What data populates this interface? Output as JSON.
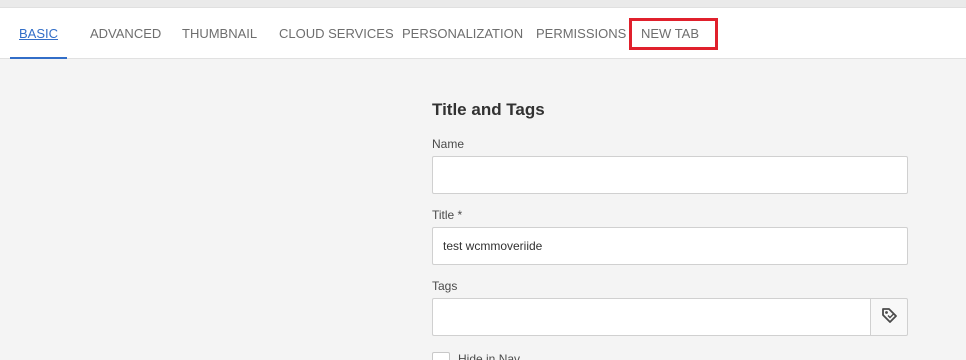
{
  "tabs": [
    {
      "label": "BASIC",
      "active": true
    },
    {
      "label": "ADVANCED",
      "active": false
    },
    {
      "label": "THUMBNAIL",
      "active": false
    },
    {
      "label": "CLOUD SERVICES",
      "active": false
    },
    {
      "label": "PERSONALIZATION",
      "active": false
    },
    {
      "label": "PERMISSIONS",
      "active": false
    },
    {
      "label": "NEW TAB",
      "active": false
    }
  ],
  "form": {
    "section_title": "Title and Tags",
    "name_label": "Name",
    "name_value": "",
    "title_label": "Title *",
    "title_value": "test wcmmoveriide",
    "tags_label": "Tags",
    "tags_value": "",
    "checkbox_label": "Hide in Nav"
  },
  "colors": {
    "accent": "#326ec8",
    "highlight": "#e0202c"
  },
  "icons": {
    "tags_button": "tag-icon"
  }
}
